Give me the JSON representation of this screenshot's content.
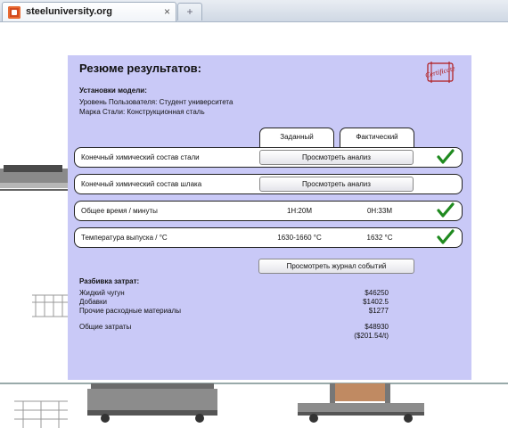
{
  "browser": {
    "tab_title": "steeluniversity.org",
    "close_symbol": "×",
    "new_tab_symbol": "+"
  },
  "panel": {
    "title": "Резюме результатов:",
    "certificate_text": "Certificate",
    "model_settings": {
      "heading": "Установки модели:",
      "user_level": "Уровень Пользователя: Студент университета",
      "steel_grade": "Марка Стали: Конструкционная сталь"
    },
    "columns": {
      "target": "Заданный",
      "actual": "Фактический"
    },
    "rows": [
      {
        "label": "Конечный химический состав стали",
        "button": "Просмотреть анализ",
        "checked": true
      },
      {
        "label": "Конечный химический состав шлака",
        "button": "Просмотреть анализ",
        "checked": false
      },
      {
        "label": "Общее время / минуты",
        "target": "1Н:20М",
        "actual": "0Н:33М",
        "checked": true
      },
      {
        "label": "Температура выпуска / °C",
        "target": "1630-1660 °C",
        "actual": "1632 °C",
        "checked": true
      }
    ],
    "event_log_button": "Просмотреть журнал событий",
    "costs": {
      "heading": "Разбивка затрат:",
      "items": [
        {
          "label": "Жидкий чугун",
          "value": "$46250"
        },
        {
          "label": "Добавки",
          "value": "$1402.5"
        },
        {
          "label": "Прочие расходные материалы",
          "value": "$1277"
        }
      ],
      "total_label": "Общие затраты",
      "total_value": "$48930",
      "per_ton": "($201.54/t)"
    }
  },
  "colors": {
    "panel_bg": "#c9c9f7",
    "check_green": "#1f8a1f"
  },
  "icons": {
    "check": "green-checkmark-icon",
    "certificate": "certificate-stamp-icon"
  }
}
